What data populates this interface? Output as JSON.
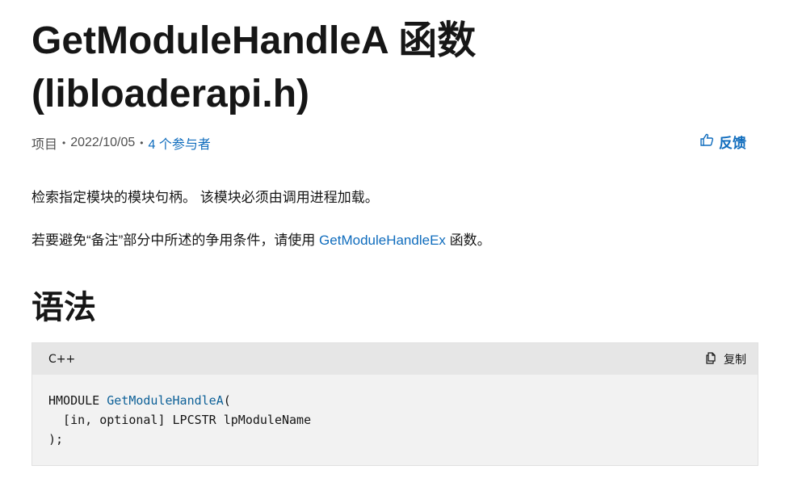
{
  "title": "GetModuleHandleA 函数 (libloaderapi.h)",
  "meta": {
    "type": "项目",
    "sep": "•",
    "date": "2022/10/05",
    "contributors": "4 个参与者"
  },
  "feedback_label": "反馈",
  "intro": "检索指定模块的模块句柄。 该模块必须由调用进程加载。",
  "note": {
    "prefix": "若要避免“备注”部分中所述的争用条件，请使用 ",
    "link": "GetModuleHandleEx",
    "suffix": " 函数。"
  },
  "syntax_heading": "语法",
  "code": {
    "language": "C++",
    "copy_label": "复制",
    "line1_type": "HMODULE ",
    "line1_fn": "GetModuleHandleA",
    "line1_end": "(",
    "line2": "  [in, optional] LPCSTR lpModuleName",
    "line3": ");"
  },
  "colors": {
    "link": "#0f6cbd",
    "code_function": "#0e6198",
    "code_bg": "#f2f2f2",
    "code_header_bg": "#e6e6e6"
  },
  "icons": [
    "thumbs-up-icon",
    "copy-icon"
  ]
}
